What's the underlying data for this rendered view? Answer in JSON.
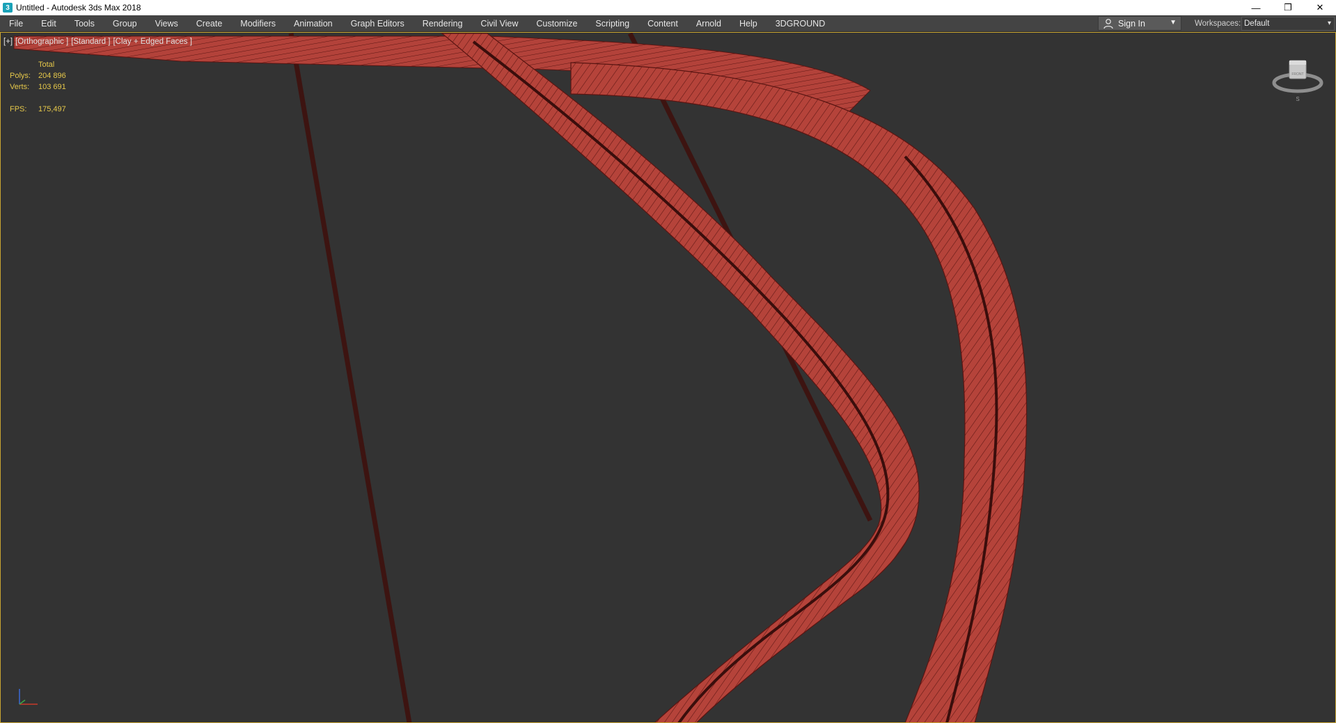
{
  "window": {
    "title": "Untitled - Autodesk 3ds Max 2018",
    "app_icon_glyph": "3",
    "controls": {
      "minimize": "—",
      "restore": "❐",
      "close": "✕"
    }
  },
  "menu": [
    "File",
    "Edit",
    "Tools",
    "Group",
    "Views",
    "Create",
    "Modifiers",
    "Animation",
    "Graph Editors",
    "Rendering",
    "Civil View",
    "Customize",
    "Scripting",
    "Content",
    "Arnold",
    "Help",
    "3DGROUND"
  ],
  "account": {
    "sign_in_label": "Sign In"
  },
  "workspaces": {
    "label": "Workspaces:",
    "value": "Default"
  },
  "viewport": {
    "labels": [
      "[+]",
      "[Orthographic ]",
      "[Standard ]",
      "[Clay + Edged Faces ]"
    ],
    "stats": {
      "header": "Total",
      "polys_label": "Polys:",
      "polys": "204 896",
      "verts_label": "Verts:",
      "verts": "103 691",
      "fps_label": "FPS:",
      "fps": "175,497"
    },
    "viewcube": {
      "face": "FRONT",
      "compass_s": "S"
    }
  },
  "colors": {
    "viewport_bg": "#333333",
    "mesh_fill": "#b5433a",
    "mesh_edge": "#5a1512",
    "stat_text": "#e6c84a",
    "active_border": "#c9a531"
  }
}
